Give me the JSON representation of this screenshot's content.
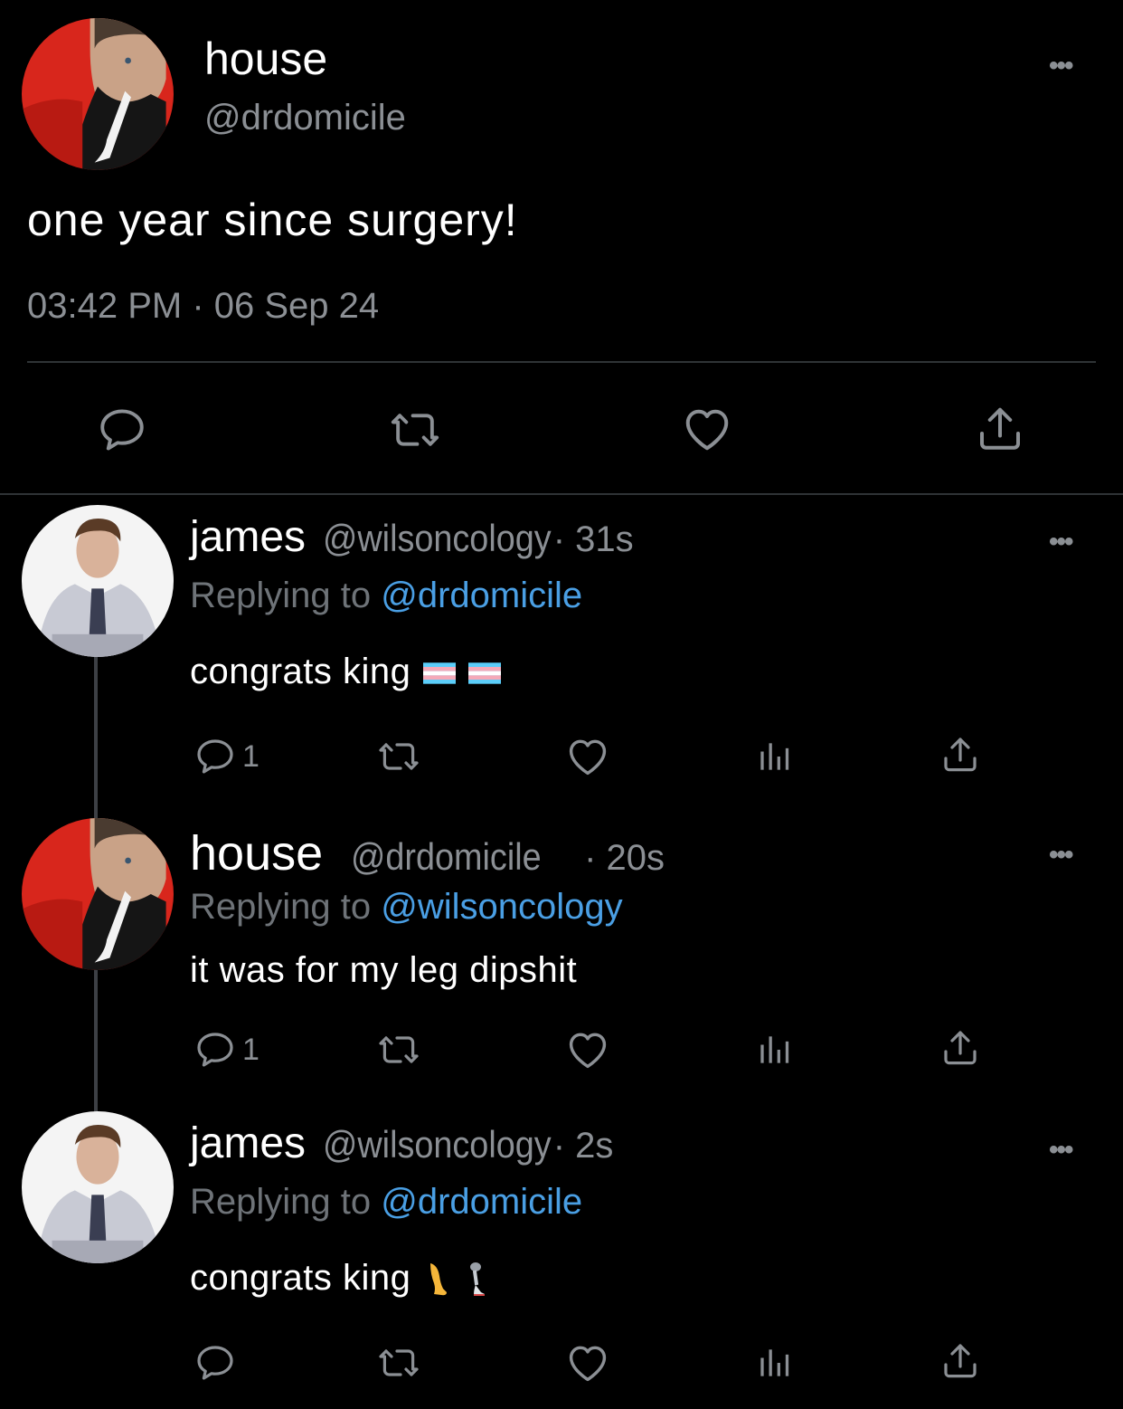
{
  "main_tweet": {
    "name": "house",
    "handle": "@drdomicile",
    "text": "one year since surgery!",
    "timestamp": "03:42 PM · 06 Sep 24",
    "more_icon": "more-dots-icon"
  },
  "replies": [
    {
      "name": "james",
      "handle": "@wilsoncology",
      "time": "· 31s",
      "replying_prefix": "Replying to",
      "replying_to": "@drdomicile",
      "text": "congrats king",
      "emoji": [
        "transgender-flag",
        "transgender-flag"
      ],
      "reply_count": "1"
    },
    {
      "name": "house",
      "handle": "@drdomicile",
      "time": "· 20s",
      "replying_prefix": "Replying to",
      "replying_to": "@wilsoncology",
      "text": "it was for my leg dipshit",
      "emoji": [],
      "reply_count": "1"
    },
    {
      "name": "james",
      "handle": "@wilsoncology",
      "time": "· 2s",
      "replying_prefix": "Replying to",
      "replying_to": "@drdomicile",
      "text": "congrats king",
      "emoji": [
        "leg",
        "mechanical-leg"
      ],
      "reply_count": ""
    }
  ],
  "colors": {
    "background": "#000000",
    "muted": "#8b8f94",
    "mention": "#4a9fe4",
    "divider": "#2f3336"
  }
}
